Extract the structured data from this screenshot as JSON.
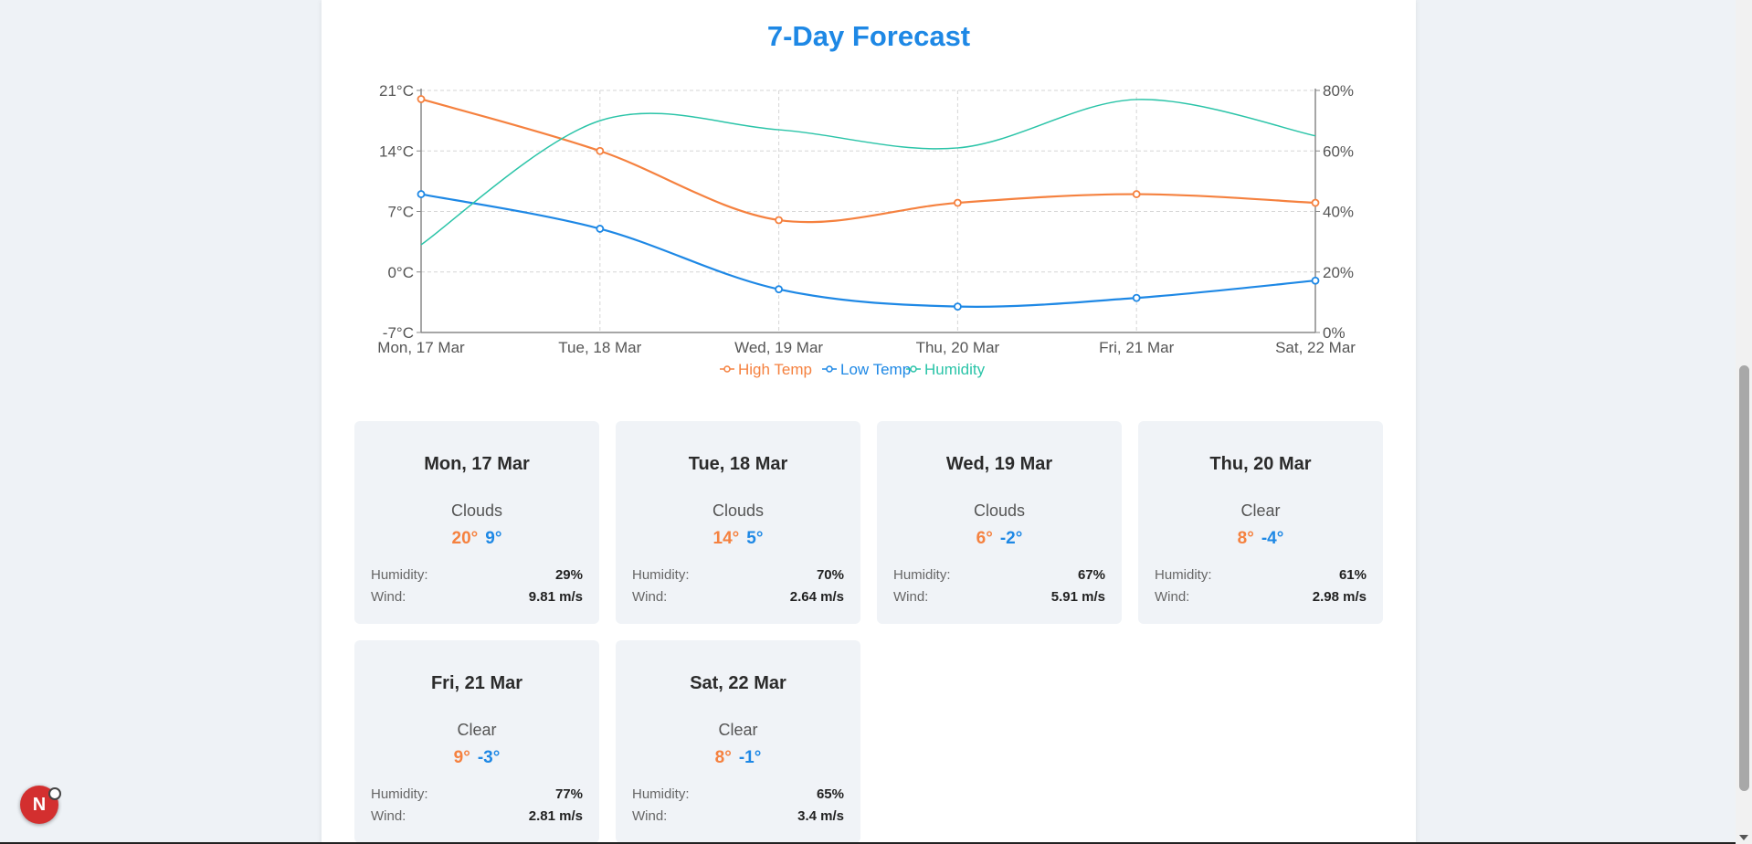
{
  "title": "7-Day Forecast",
  "colors": {
    "high": "#f5813f",
    "low": "#1e88e5",
    "humidity": "#2bc4a8",
    "title": "#1e88e5"
  },
  "chart_data": {
    "type": "line",
    "x": [
      "Mon, 17 Mar",
      "Tue, 18 Mar",
      "Wed, 19 Mar",
      "Thu, 20 Mar",
      "Fri, 21 Mar",
      "Sat, 22 Mar"
    ],
    "y_left": {
      "ticks": [
        "21°C",
        "14°C",
        "7°C",
        "0°C",
        "-7°C"
      ],
      "tick_values": [
        21,
        14,
        7,
        0,
        -7
      ],
      "range": [
        -7,
        21
      ]
    },
    "y_right": {
      "ticks": [
        "80%",
        "60%",
        "40%",
        "20%",
        "0%"
      ],
      "tick_values": [
        80,
        60,
        40,
        20,
        0
      ],
      "range": [
        0,
        80
      ]
    },
    "series": [
      {
        "name": "High Temp",
        "axis": "left",
        "values": [
          20,
          14,
          6,
          8,
          9,
          8
        ],
        "points": true
      },
      {
        "name": "Low Temp",
        "axis": "left",
        "values": [
          9,
          5,
          -2,
          -4,
          -3,
          -1
        ],
        "points": true
      },
      {
        "name": "Humidity",
        "axis": "right",
        "values": [
          29,
          70,
          67,
          61,
          77,
          65
        ],
        "points": false
      }
    ],
    "grid": true,
    "legend": "bottom-center"
  },
  "cards": [
    {
      "date": "Mon, 17 Mar",
      "condition": "Clouds",
      "high": "20°",
      "low": "9°",
      "humidity_label": "Humidity:",
      "humidity": "29%",
      "wind_label": "Wind:",
      "wind": "9.81 m/s"
    },
    {
      "date": "Tue, 18 Mar",
      "condition": "Clouds",
      "high": "14°",
      "low": "5°",
      "humidity_label": "Humidity:",
      "humidity": "70%",
      "wind_label": "Wind:",
      "wind": "2.64 m/s"
    },
    {
      "date": "Wed, 19 Mar",
      "condition": "Clouds",
      "high": "6°",
      "low": "-2°",
      "humidity_label": "Humidity:",
      "humidity": "67%",
      "wind_label": "Wind:",
      "wind": "5.91 m/s"
    },
    {
      "date": "Thu, 20 Mar",
      "condition": "Clear",
      "high": "8°",
      "low": "-4°",
      "humidity_label": "Humidity:",
      "humidity": "61%",
      "wind_label": "Wind:",
      "wind": "2.98 m/s"
    },
    {
      "date": "Fri, 21 Mar",
      "condition": "Clear",
      "high": "9°",
      "low": "-3°",
      "humidity_label": "Humidity:",
      "humidity": "77%",
      "wind_label": "Wind:",
      "wind": "2.81 m/s"
    },
    {
      "date": "Sat, 22 Mar",
      "condition": "Clear",
      "high": "8°",
      "low": "-1°",
      "humidity_label": "Humidity:",
      "humidity": "65%",
      "wind_label": "Wind:",
      "wind": "3.4 m/s"
    }
  ],
  "badge": {
    "label": "N"
  }
}
